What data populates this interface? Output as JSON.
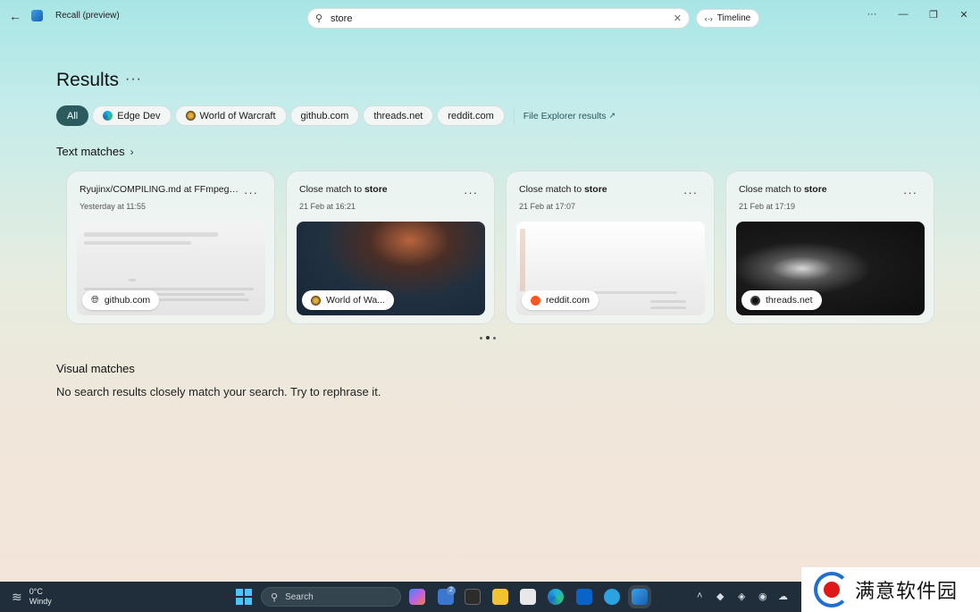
{
  "window": {
    "app_title": "Recall (preview)",
    "search_value": "store",
    "timeline_label": "Timeline"
  },
  "results": {
    "title": "Results",
    "more": "···"
  },
  "filters": [
    {
      "label": "All",
      "active": true
    },
    {
      "label": "Edge Dev",
      "icon": "edge-icon"
    },
    {
      "label": "World of Warcraft",
      "icon": "wow-icon"
    },
    {
      "label": "github.com"
    },
    {
      "label": "threads.net"
    },
    {
      "label": "reddit.com"
    }
  ],
  "file_explorer_link": "File Explorer results",
  "text_matches": {
    "title": "Text matches",
    "cards": [
      {
        "title": "Ryujinx/COMPILING.md at FFmpeg-fo...",
        "date": "Yesterday at 11:55",
        "source": "github.com",
        "source_icon": "globe-icon"
      },
      {
        "title_prefix": "Close match to ",
        "title_bold": "store",
        "date": "21 Feb at 16:21",
        "source": "World of Wa...",
        "source_icon": "wow-icon"
      },
      {
        "title_prefix": "Close match to ",
        "title_bold": "store",
        "date": "21 Feb at 17:07",
        "source": "reddit.com",
        "source_icon": "reddit-icon"
      },
      {
        "title_prefix": "Close match to ",
        "title_bold": "store",
        "date": "21 Feb at 17:19",
        "source": "threads.net",
        "source_icon": "threads-icon"
      }
    ]
  },
  "visual_matches": {
    "title": "Visual matches",
    "message": "No search results closely match your search. Try to rephrase it."
  },
  "taskbar": {
    "temperature": "0°C",
    "condition": "Windy",
    "search_placeholder": "Search",
    "mail_badge": "2"
  },
  "watermark": {
    "text": "满意软件园"
  },
  "colors": {
    "active_chip": "#2c5b5f",
    "taskbar": "#1f2e3a"
  }
}
